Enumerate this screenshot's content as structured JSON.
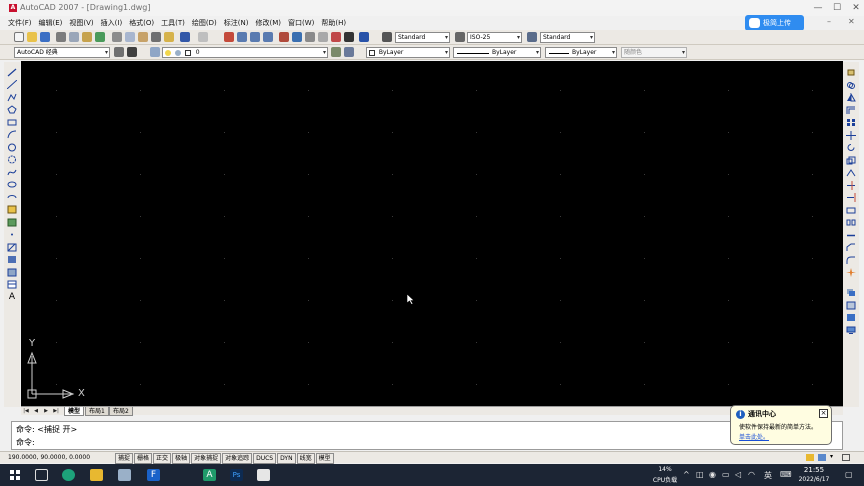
{
  "title": "AutoCAD 2007 - [Drawing1.dwg]",
  "window_controls": {
    "minimize": "—",
    "maximize": "☐",
    "close": "✕"
  },
  "upload_button": {
    "label": "极简上传",
    "color": "#2f8cf0"
  },
  "menu": [
    "文件(F)",
    "编辑(E)",
    "视图(V)",
    "插入(I)",
    "格式(O)",
    "工具(T)",
    "绘图(D)",
    "标注(N)",
    "修改(M)",
    "窗口(W)",
    "帮助(H)"
  ],
  "toolbar": {
    "text_style": "Standard",
    "dim_style": "ISO-25",
    "table_style": "Standard",
    "workspace": "AutoCAD 经典",
    "layer": "0",
    "color": "ByLayer",
    "linetype": "ByLayer",
    "lineweight": "ByLayer",
    "plot_style": "随颜色"
  },
  "canvas": {
    "background": "#000000",
    "ucs": {
      "y_label": "Y",
      "x_label": "X"
    }
  },
  "layout_tabs": [
    {
      "label": "模型",
      "active": true
    },
    {
      "label": "布局1",
      "active": false
    },
    {
      "label": "布局2",
      "active": false
    }
  ],
  "command": {
    "line1": "命令: <捕捉 开>",
    "line2": "命令:"
  },
  "status": {
    "coordinates": "190.0000, 90.0000, 0.0000",
    "modes": [
      "捕捉",
      "栅格",
      "正交",
      "极轴",
      "对象捕捉",
      "对象追踪",
      "DUCS",
      "DYN",
      "线宽",
      "模型"
    ]
  },
  "notification": {
    "title": "通讯中心",
    "body": "使软件保持最新的简单方法。",
    "link": "单击此处。"
  },
  "taskbar": {
    "cpu_usage": "14%",
    "cpu_label": "CPU负载",
    "ime": "英",
    "time": "21:55",
    "date": "2022/6/17"
  }
}
